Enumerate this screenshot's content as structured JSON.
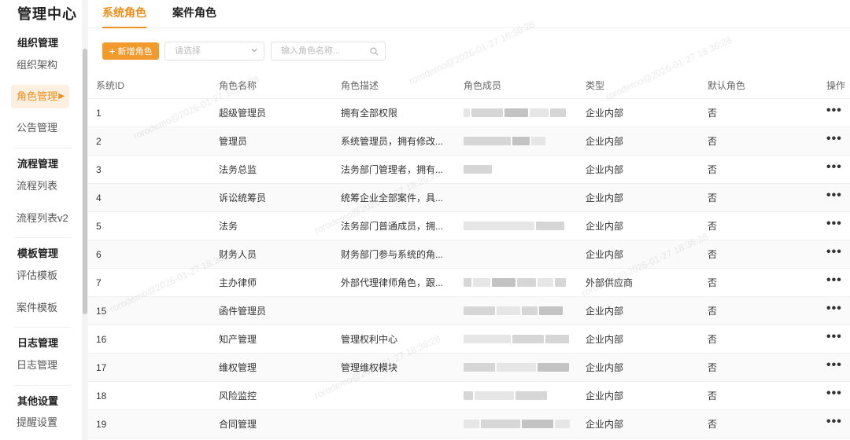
{
  "app": {
    "title": "管理中心"
  },
  "sidebar": {
    "groups": [
      {
        "title": "组织管理",
        "items": [
          "组织架构",
          "角色管理",
          "公告管理"
        ]
      },
      {
        "title": "流程管理",
        "items": [
          "流程列表",
          "流程列表v2"
        ]
      },
      {
        "title": "模板管理",
        "items": [
          "评估模板",
          "案件模板"
        ]
      },
      {
        "title": "日志管理",
        "items": [
          "日志管理"
        ]
      },
      {
        "title": "其他设置",
        "items": [
          "提醒设置"
        ]
      }
    ],
    "active_item": "角色管理"
  },
  "tabs": [
    {
      "label": "系统角色",
      "active": true
    },
    {
      "label": "案件角色",
      "active": false
    }
  ],
  "toolbar": {
    "add_label": "新增角色",
    "select_placeholder": "请选择",
    "search_placeholder": "输入角色名称..."
  },
  "table": {
    "columns": [
      "系统ID",
      "角色名称",
      "角色描述",
      "角色成员",
      "类型",
      "默认角色",
      "操作"
    ],
    "rows": [
      {
        "id": "1",
        "name": "超级管理员",
        "desc": "拥有全部权限",
        "member": "",
        "type": "企业内部",
        "default": "否"
      },
      {
        "id": "2",
        "name": "管理员",
        "desc": "系统管理员，拥有修改...",
        "member": "",
        "type": "企业内部",
        "default": "否"
      },
      {
        "id": "3",
        "name": "法务总监",
        "desc": "法务部门管理者，拥有...",
        "member": "",
        "type": "企业内部",
        "default": "否"
      },
      {
        "id": "4",
        "name": "诉讼统筹员",
        "desc": "统筹企业全部案件，具...",
        "member": "",
        "type": "企业内部",
        "default": "否"
      },
      {
        "id": "5",
        "name": "法务",
        "desc": "法务部门普通成员，拥...",
        "member": "",
        "type": "企业内部",
        "default": "否"
      },
      {
        "id": "6",
        "name": "财务人员",
        "desc": "财务部门参与系统的角...",
        "member": "",
        "type": "企业内部",
        "default": "否"
      },
      {
        "id": "7",
        "name": "主办律师",
        "desc": "外部代理律师角色，跟...",
        "member": "",
        "type": "外部供应商",
        "default": "否"
      },
      {
        "id": "15",
        "name": "函件管理员",
        "desc": "",
        "member": "",
        "type": "企业内部",
        "default": "否"
      },
      {
        "id": "16",
        "name": "知产管理",
        "desc": "管理权利中心",
        "member": "",
        "type": "企业内部",
        "default": "否"
      },
      {
        "id": "17",
        "name": "维权管理",
        "desc": "管理维权模块",
        "member": "",
        "type": "企业内部",
        "default": "否"
      },
      {
        "id": "18",
        "name": "风险监控",
        "desc": "",
        "member": "",
        "type": "企业内部",
        "default": "否"
      },
      {
        "id": "19",
        "name": "合同管理",
        "desc": "",
        "member": "",
        "type": "企业内部",
        "default": "否"
      }
    ],
    "more_glyph": "•••"
  },
  "colors": {
    "accent": "#f08c1a",
    "accent_button": "#f39a2c",
    "active_bg": "#fdf0e1"
  },
  "icons": {
    "add": "plus-icon",
    "select": "chevron-down-icon",
    "search": "search-icon",
    "row_action": "more-icon",
    "active_nav": "caret-right-icon"
  }
}
